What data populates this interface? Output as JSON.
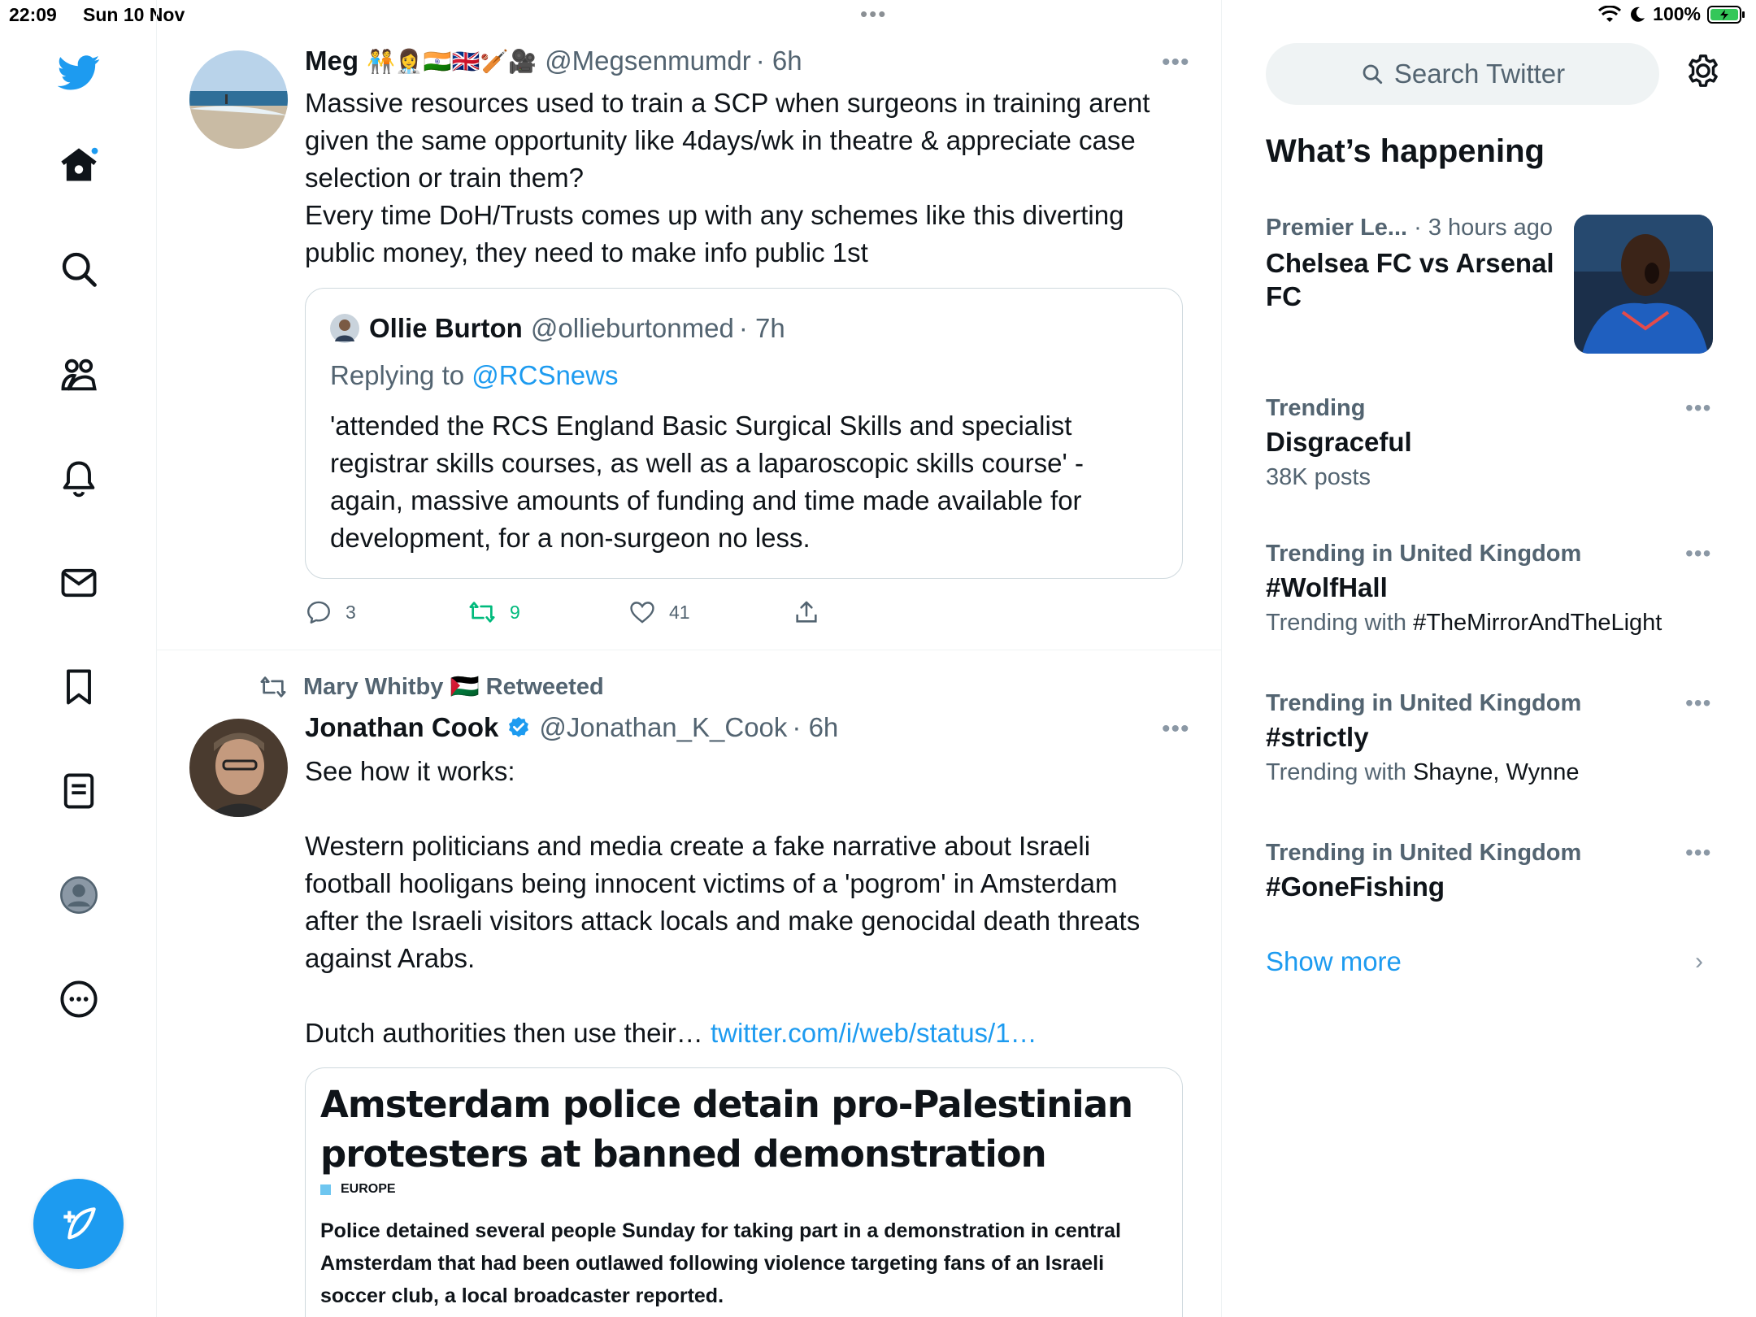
{
  "status_bar": {
    "time": "22:09",
    "date": "Sun 10 Nov",
    "battery": "100%"
  },
  "nav": {
    "items": [
      "twitter-logo",
      "home",
      "explore",
      "communities",
      "notifications",
      "messages",
      "bookmarks",
      "lists",
      "profile",
      "more"
    ]
  },
  "tweets": [
    {
      "name": "Meg",
      "name_emojis": "🧑‍🤝‍🧑👩‍⚕️🇮🇳🇬🇧🏏🎥",
      "handle": "@Megsenmumdr",
      "time": "· 6h",
      "text": "Massive resources used to train a SCP when surgeons in training arent given the same opportunity like 4days/wk in theatre & appreciate case selection or train them?\nEvery time DoH/Trusts comes up with any schemes like this diverting public money, they need to make info public 1st",
      "quote": {
        "name": "Ollie Burton",
        "handle": "@ollieburtonmed",
        "time": "· 7h",
        "replying_prefix": "Replying to",
        "replying_to": "@RCSnews",
        "text": "'attended the RCS England Basic Surgical Skills and specialist registrar skills courses, as well as a laparoscopic skills course'  - again, massive amounts of funding and time made available for development, for a non-surgeon no less."
      },
      "replies": "3",
      "retweets": "9",
      "likes": "41"
    },
    {
      "retweeted_by": "Mary Whitby 🇵🇸 Retweeted",
      "name": "Jonathan Cook",
      "handle": "@Jonathan_K_Cook",
      "time": "· 6h",
      "text": "See how it works:\n\nWestern politicians and media create a fake narrative about Israeli football hooligans being innocent victims of a 'pogrom' in Amsterdam after the Israeli visitors attack locals and make genocidal death threats against Arabs.\n\nDutch authorities then use their… ",
      "link": "twitter.com/i/web/status/1…",
      "card": {
        "headline": "Amsterdam police detain pro-Palestinian protesters at banned demonstration",
        "section": "EUROPE",
        "summary": "Police detained several people Sunday for taking part in a demonstration in central Amsterdam that had been outlawed following violence targeting fans of an Israeli soccer club, a local broadcaster reported."
      }
    }
  ],
  "sidebar": {
    "search_placeholder": "Search Twitter",
    "whats_happening": "What’s happening",
    "featured": {
      "context": "Premier Le...",
      "time": "· 3 hours ago",
      "topic": "Chelsea FC vs Arsenal FC"
    },
    "trends": [
      {
        "context": "Trending",
        "topic": "Disgraceful",
        "sub_prefix": "38K posts",
        "sub_value": ""
      },
      {
        "context": "Trending in United Kingdom",
        "topic": "#WolfHall",
        "sub_prefix": "Trending with",
        "sub_value": "#TheMirrorAndTheLight"
      },
      {
        "context": "Trending in United Kingdom",
        "topic": "#strictly",
        "sub_prefix": "Trending with",
        "sub_value": "Shayne, Wynne"
      },
      {
        "context": "Trending in United Kingdom",
        "topic": "#GoneFishing",
        "sub_prefix": "",
        "sub_value": ""
      }
    ],
    "show_more": "Show more"
  },
  "colors": {
    "accent": "#1d9bf0",
    "retweet_green": "#00ba7c",
    "text_primary": "#0f1419",
    "text_secondary": "#536471"
  }
}
